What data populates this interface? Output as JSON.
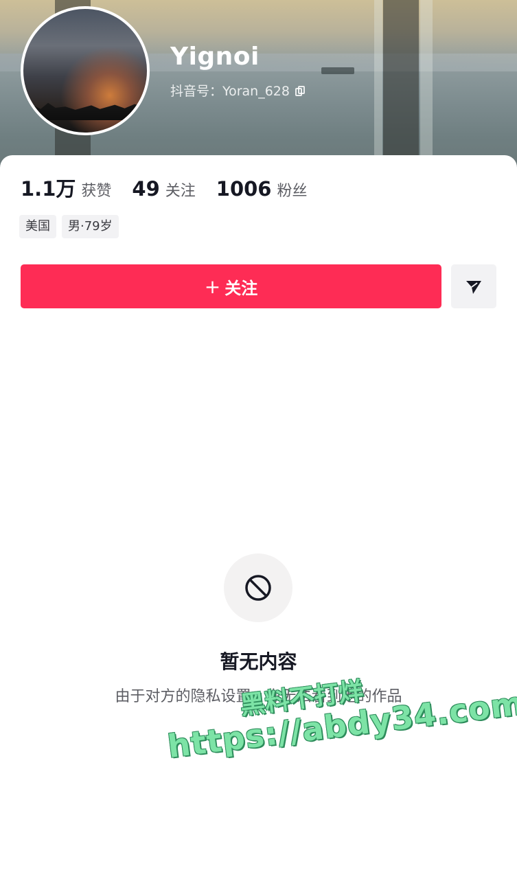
{
  "profile": {
    "username": "Yignoi",
    "douyin_id": "抖音号：Yoran_628"
  },
  "stats": {
    "likes": {
      "value": "1.1万",
      "label": "获赞"
    },
    "following": {
      "value": "49",
      "label": "关注"
    },
    "followers": {
      "value": "1006",
      "label": "粉丝"
    }
  },
  "tags": [
    "美国",
    "男·79岁"
  ],
  "actions": {
    "follow_plus": "+",
    "follow_label": "关注"
  },
  "empty_state": {
    "title": "暂无内容",
    "description": "由于对方的隐私设置，你无法看到他的作品"
  },
  "watermark": {
    "line1": "黑料不打烊",
    "line2": "https://abdy34.com"
  },
  "colors": {
    "accent": "#fe2c55",
    "watermark": "#7de3a6"
  }
}
